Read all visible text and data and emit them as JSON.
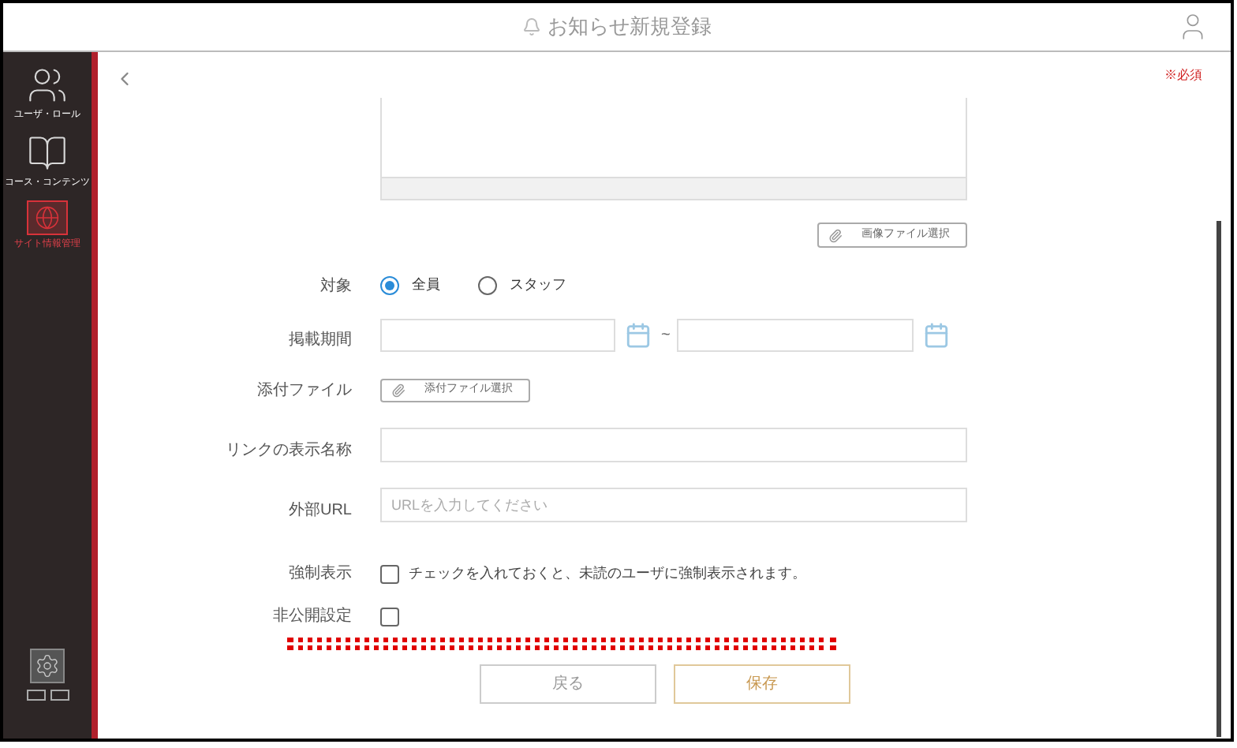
{
  "header": {
    "title": "お知らせ新規登録"
  },
  "sidebar": {
    "items": [
      {
        "label": "ユーザ・ロール",
        "selected": false,
        "kind": "users"
      },
      {
        "label": "コース・コンテンツ",
        "selected": false,
        "kind": "course"
      },
      {
        "label": "サイト情報管理",
        "selected": true,
        "kind": "site"
      }
    ]
  },
  "required_note": "※必須",
  "form": {
    "image_button": "画像ファイル選択",
    "target": {
      "label": "対象",
      "options": [
        {
          "label": "全員",
          "selected": true
        },
        {
          "label": "スタッフ",
          "selected": false
        }
      ]
    },
    "period": {
      "label": "掲載期間",
      "separator": "~"
    },
    "attachment": {
      "label": "添付ファイル",
      "button": "添付ファイル選択"
    },
    "link_name": {
      "label": "リンクの表示名称"
    },
    "url": {
      "label": "外部URL",
      "placeholder": "URLを入力してください"
    },
    "force": {
      "label": "強制表示",
      "checked": false,
      "text": "チェックを入れておくと、未読のユーザに強制表示されます。"
    },
    "private": {
      "label": "非公開設定",
      "checked": false
    }
  },
  "highlight": {
    "kind": "dotted-line"
  },
  "buttons": [
    {
      "label": "戻る",
      "kind": "back"
    },
    {
      "label": "保存",
      "kind": "save"
    }
  ]
}
